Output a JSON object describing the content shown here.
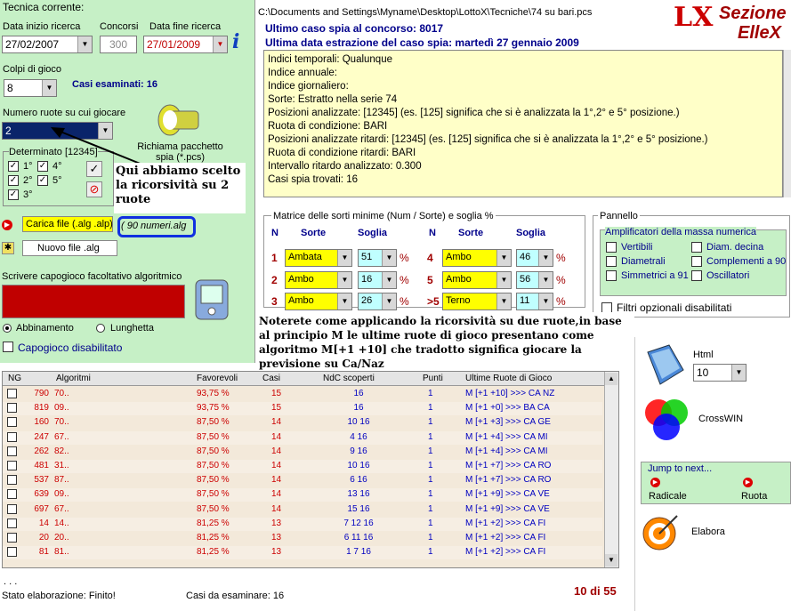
{
  "left": {
    "title": "Tecnica corrente:",
    "date_start_label": "Data inizio ricerca",
    "date_start": "27/02/2007",
    "concorsi_label": "Concorsi",
    "concorsi": "300",
    "date_end_label": "Data fine ricerca",
    "date_end": "27/01/2009",
    "colpi_label": "Colpi di gioco",
    "colpi": "8",
    "casi_label": "Casi esaminati: 16",
    "ruote_label": "Numero ruote su cui giocare",
    "ruote": "2",
    "richiama": "Richiama pacchetto spia (*.pcs)",
    "determinato": "Determinato [12345]",
    "checks": [
      "1°",
      "4°",
      "2°",
      "5°",
      "3°"
    ],
    "annotation": "Qui abbiamo scelto la ricorsività su 2 ruote",
    "carica": "Carica file (.alg .alp)",
    "numeri_alg": "( 90 numeri.alg",
    "nuovo": "Nuovo file .alg",
    "scrivere": "Scrivere capogioco facoltativo algoritmico",
    "abbinamento": "Abbinamento",
    "lunghetta": "Lunghetta",
    "capogioco": "Capogioco disabilitato"
  },
  "header": {
    "path": "C:\\Documents and Settings\\Myname\\Desktop\\LottoX\\Tecniche\\74 su bari.pcs",
    "ultimo": "Ultimo caso spia al concorso:  8017",
    "ultima": "Ultima data estrazione del caso spia:  martedì 27 gennaio 2009",
    "brand1": "Sezione",
    "brand2": "ElleX",
    "logo": "LX"
  },
  "info_lines": [
    "Indici temporali: Qualunque",
    "Indice annuale:",
    "Indice giornaliero:",
    "Sorte: Estratto nella serie 74",
    "Posizioni analizzate: [12345] (es. [125] significa che si è analizzata la 1°,2° e 5° posizione.)",
    "Ruota di condizione: BARI",
    "Posizioni analizzate ritardi: [12345] (es. [125] significa che si è analizzata la 1°,2° e 5° posizione.)",
    "Ruota di condizione ritardi: BARI",
    "Intervallo ritardo analizzato: 0.300",
    "Casi spia trovati: 16"
  ],
  "matrice": {
    "title": "Matrice delle sorti minime (Num / Sorte) e soglia %",
    "h_n": "N",
    "h_sorte": "Sorte",
    "h_soglia": "Soglia",
    "rows": [
      {
        "n": "1",
        "sorte": "Ambata",
        "soglia": "51",
        "n2": "4",
        "sorte2": "Ambo",
        "soglia2": "46"
      },
      {
        "n": "2",
        "sorte": "Ambo",
        "soglia": "16",
        "n2": "5",
        "sorte2": "Ambo",
        "soglia2": "56"
      },
      {
        "n": "3",
        "sorte": "Ambo",
        "soglia": "26",
        "n2": ">5",
        "sorte2": "Terno",
        "soglia2": "11"
      }
    ],
    "pct": "%"
  },
  "pannello": {
    "title": "Pannello",
    "amp": "Amplificatori della massa numerica",
    "opts": [
      "Vertibili",
      "Diam. decina",
      "Diametrali",
      "Complementi a 90",
      "Simmetrici a 91",
      "Oscillatori"
    ],
    "filtri": "Filtri opzionali disabilitati"
  },
  "note": "Noterete come applicando la ricorsività su due ruote,in base al principio M le ultime ruote di gioco presentano come algoritmo M[+1 +10] che tradotto significa giocare la previsione su Ca/Naz",
  "table": {
    "headers": [
      "NG",
      "Algoritmi",
      "Favorevoli",
      "Casi",
      "NdC scoperti",
      "Punti",
      "Ultime Ruote di Gioco"
    ],
    "rows": [
      [
        "790",
        "70..",
        "93,75 %",
        "15",
        "16",
        "1",
        "M [+1 +10] >>> CA NZ"
      ],
      [
        "819",
        "09..",
        "93,75 %",
        "15",
        "16",
        "1",
        "M [+1 +0] >>> BA CA"
      ],
      [
        "160",
        "70..",
        "87,50 %",
        "14",
        "10 16",
        "1",
        "M [+1 +3] >>> CA GE"
      ],
      [
        "247",
        "67..",
        "87,50 %",
        "14",
        "4 16",
        "1",
        "M [+1 +4] >>> CA MI"
      ],
      [
        "262",
        "82..",
        "87,50 %",
        "14",
        "9 16",
        "1",
        "M [+1 +4] >>> CA MI"
      ],
      [
        "481",
        "31..",
        "87,50 %",
        "14",
        "10 16",
        "1",
        "M [+1 +7] >>> CA RO"
      ],
      [
        "537",
        "87..",
        "87,50 %",
        "14",
        "6 16",
        "1",
        "M [+1 +7] >>> CA RO"
      ],
      [
        "639",
        "09..",
        "87,50 %",
        "14",
        "13 16",
        "1",
        "M [+1 +9] >>> CA VE"
      ],
      [
        "697",
        "67..",
        "87,50 %",
        "14",
        "15 16",
        "1",
        "M [+1 +9] >>> CA VE"
      ],
      [
        "14",
        "14..",
        "81,25 %",
        "13",
        "7 12 16",
        "1",
        "M [+1 +2] >>> CA FI"
      ],
      [
        "20",
        "20..",
        "81,25 %",
        "13",
        "6 11 16",
        "1",
        "M [+1 +2] >>> CA FI"
      ],
      [
        "81",
        "81..",
        "81,25 %",
        "13",
        "1 7 16",
        "1",
        "M [+1 +2] >>> CA FI"
      ]
    ]
  },
  "status": {
    "stato": "Stato elaborazione:  Finito!",
    "casi": "Casi da esaminare: 16",
    "page": "10 di 55",
    "dots": ". . ."
  },
  "right": {
    "html": "Html",
    "html_val": "10",
    "crosswin": "CrossWIN",
    "jump": "Jump to next...",
    "radicale": "Radicale",
    "ruota": "Ruota",
    "elabora": "Elabora"
  },
  "colors": {
    "panel_green": "#c6f0c6",
    "info_yellow": "#ffffc8",
    "select_yellow": "#ffff00",
    "soglia_cyan": "#c0ffff",
    "red_input": "#c00000",
    "blue_text": "#00008b",
    "dark_red": "#a00000"
  }
}
